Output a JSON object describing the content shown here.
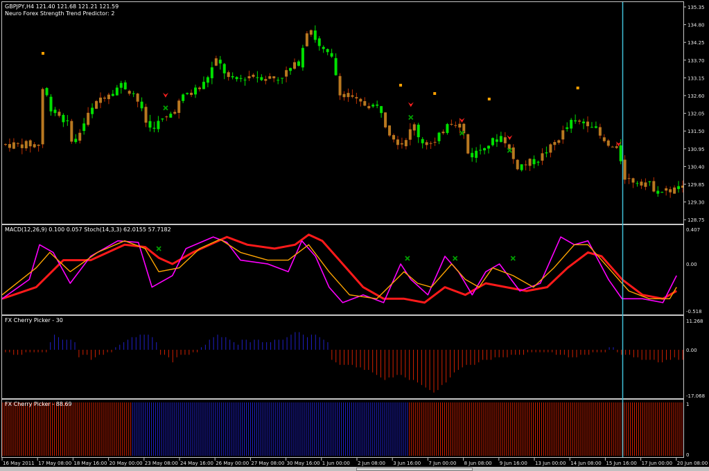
{
  "header": {
    "symbol_line": "GBPJPY,H4  121.40 121.68 121.21 121.59",
    "indicator_line": "Neuro Forex Strength Trend Predictor: 2"
  },
  "panes": {
    "macd_label": "MACD(12,26,9) 0.100 0.057  Stoch(14,3,3) 62.0155 57.7182",
    "cherry1_label": "FX Cherry Picker - 30",
    "cherry2_label": "FX Cherry Picker - 88.69"
  },
  "colors": {
    "bull": "#00e000",
    "bear": "#b87820",
    "macd": "#ff1a1a",
    "stoch_main": "#ff00ff",
    "stoch_signal": "#ffa500",
    "hist_pos": "#2020c8",
    "hist_neg": "#d02000",
    "vline": "#40c0d8",
    "marker_x": "#00a000",
    "arrow": "#ff2020",
    "dot": "#ffa000"
  },
  "chart_data": [
    {
      "type": "candlestick",
      "title": "GBPJPY,H4",
      "y_ticks": [
        "135.35",
        "134.80",
        "134.25",
        "133.70",
        "133.15",
        "132.60",
        "132.05",
        "131.50",
        "130.95",
        "130.40",
        "129.85",
        "129.30",
        "128.75"
      ],
      "ylim": [
        128.75,
        135.35
      ],
      "bull_runs": [
        {
          "from": 0.055,
          "to": 0.19,
          "lo": 130.9,
          "hi": 133.05
        },
        {
          "from": 0.215,
          "to": 0.245,
          "lo": 131.7,
          "hi": 132.4
        },
        {
          "from": 0.255,
          "to": 0.42,
          "lo": 131.9,
          "hi": 134.8
        },
        {
          "from": 0.43,
          "to": 0.49,
          "lo": 133.2,
          "hi": 135.0
        },
        {
          "from": 0.635,
          "to": 0.65,
          "lo": 131.0,
          "hi": 131.9
        },
        {
          "from": 0.69,
          "to": 0.73,
          "lo": 130.7,
          "hi": 131.4
        },
        {
          "from": 0.76,
          "to": 0.8,
          "lo": 130.2,
          "hi": 131.2
        },
        {
          "from": 0.82,
          "to": 0.87,
          "lo": 131.2,
          "hi": 132.3
        }
      ],
      "path": [
        [
          0,
          131.0
        ],
        [
          0.05,
          131.0
        ],
        [
          0.055,
          132.95
        ],
        [
          0.065,
          132.2
        ],
        [
          0.09,
          131.7
        ],
        [
          0.1,
          131.0
        ],
        [
          0.12,
          131.9
        ],
        [
          0.14,
          132.5
        ],
        [
          0.17,
          132.9
        ],
        [
          0.19,
          132.6
        ],
        [
          0.21,
          131.5
        ],
        [
          0.24,
          131.9
        ],
        [
          0.26,
          132.5
        ],
        [
          0.29,
          132.9
        ],
        [
          0.31,
          133.7
        ],
        [
          0.33,
          133.0
        ],
        [
          0.36,
          133.2
        ],
        [
          0.4,
          133.1
        ],
        [
          0.43,
          133.6
        ],
        [
          0.445,
          134.85
        ],
        [
          0.46,
          134.1
        ],
        [
          0.48,
          133.7
        ],
        [
          0.49,
          132.7
        ],
        [
          0.52,
          132.3
        ],
        [
          0.55,
          132.2
        ],
        [
          0.56,
          131.5
        ],
        [
          0.58,
          131.0
        ],
        [
          0.6,
          131.6
        ],
        [
          0.61,
          131.1
        ],
        [
          0.63,
          131.0
        ],
        [
          0.65,
          131.8
        ],
        [
          0.67,
          131.6
        ],
        [
          0.68,
          130.6
        ],
        [
          0.7,
          130.9
        ],
        [
          0.73,
          131.3
        ],
        [
          0.75,
          130.3
        ],
        [
          0.78,
          130.5
        ],
        [
          0.8,
          130.9
        ],
        [
          0.83,
          131.7
        ],
        [
          0.86,
          131.7
        ],
        [
          0.88,
          131.0
        ],
        [
          0.9,
          130.8
        ],
        [
          0.91,
          129.9
        ],
        [
          0.94,
          129.8
        ],
        [
          0.96,
          129.5
        ],
        [
          0.99,
          129.6
        ]
      ],
      "signal_arrows": [
        0.24,
        0.6,
        0.675,
        0.745,
        0.905
      ],
      "signal_x": [
        0.24,
        0.6,
        0.675,
        0.745
      ],
      "signal_dots": [
        0.06,
        0.585,
        0.635,
        0.715,
        0.845
      ]
    },
    {
      "type": "line",
      "title": "MACD(12,26,9) 0.100 0.057  Stoch(14,3,3) 62.0155 57.7182",
      "y_ticks": [
        "0.407",
        "0.00",
        "-0.518"
      ],
      "ylim": [
        -0.6,
        0.45
      ],
      "series": [
        {
          "role": "macd",
          "values": [
            [
              0,
              -0.45
            ],
            [
              0.05,
              -0.3
            ],
            [
              0.09,
              0.05
            ],
            [
              0.13,
              0.05
            ],
            [
              0.18,
              0.25
            ],
            [
              0.21,
              0.22
            ],
            [
              0.23,
              0.08
            ],
            [
              0.25,
              0.0
            ],
            [
              0.28,
              0.15
            ],
            [
              0.33,
              0.35
            ],
            [
              0.36,
              0.25
            ],
            [
              0.4,
              0.2
            ],
            [
              0.43,
              0.25
            ],
            [
              0.45,
              0.38
            ],
            [
              0.47,
              0.3
            ],
            [
              0.5,
              0.0
            ],
            [
              0.53,
              -0.3
            ],
            [
              0.56,
              -0.45
            ],
            [
              0.59,
              -0.45
            ],
            [
              0.62,
              -0.5
            ],
            [
              0.65,
              -0.3
            ],
            [
              0.68,
              -0.4
            ],
            [
              0.71,
              -0.25
            ],
            [
              0.74,
              -0.3
            ],
            [
              0.77,
              -0.35
            ],
            [
              0.8,
              -0.3
            ],
            [
              0.83,
              -0.05
            ],
            [
              0.86,
              0.15
            ],
            [
              0.88,
              0.1
            ],
            [
              0.91,
              -0.2
            ],
            [
              0.94,
              -0.4
            ],
            [
              0.97,
              -0.45
            ],
            [
              0.99,
              -0.35
            ]
          ]
        },
        {
          "role": "stoch_main",
          "values": [
            [
              0,
              -0.45
            ],
            [
              0.04,
              -0.2
            ],
            [
              0.055,
              0.25
            ],
            [
              0.075,
              0.15
            ],
            [
              0.1,
              -0.25
            ],
            [
              0.13,
              0.1
            ],
            [
              0.17,
              0.3
            ],
            [
              0.2,
              0.28
            ],
            [
              0.22,
              -0.3
            ],
            [
              0.25,
              -0.15
            ],
            [
              0.27,
              0.2
            ],
            [
              0.31,
              0.35
            ],
            [
              0.33,
              0.28
            ],
            [
              0.35,
              0.05
            ],
            [
              0.39,
              0.0
            ],
            [
              0.42,
              -0.1
            ],
            [
              0.44,
              0.3
            ],
            [
              0.46,
              0.1
            ],
            [
              0.48,
              -0.3
            ],
            [
              0.5,
              -0.5
            ],
            [
              0.53,
              -0.4
            ],
            [
              0.56,
              -0.5
            ],
            [
              0.585,
              0.0
            ],
            [
              0.6,
              -0.2
            ],
            [
              0.625,
              -0.4
            ],
            [
              0.65,
              0.1
            ],
            [
              0.67,
              -0.1
            ],
            [
              0.69,
              -0.4
            ],
            [
              0.71,
              -0.1
            ],
            [
              0.73,
              0.0
            ],
            [
              0.76,
              -0.35
            ],
            [
              0.79,
              -0.25
            ],
            [
              0.82,
              0.35
            ],
            [
              0.84,
              0.25
            ],
            [
              0.86,
              0.3
            ],
            [
              0.89,
              -0.2
            ],
            [
              0.91,
              -0.45
            ],
            [
              0.94,
              -0.45
            ],
            [
              0.97,
              -0.5
            ],
            [
              0.99,
              -0.15
            ]
          ]
        },
        {
          "role": "stoch_signal",
          "values": [
            [
              0,
              -0.4
            ],
            [
              0.05,
              -0.05
            ],
            [
              0.07,
              0.15
            ],
            [
              0.1,
              -0.1
            ],
            [
              0.14,
              0.15
            ],
            [
              0.18,
              0.3
            ],
            [
              0.21,
              0.2
            ],
            [
              0.23,
              -0.1
            ],
            [
              0.26,
              -0.05
            ],
            [
              0.29,
              0.2
            ],
            [
              0.32,
              0.32
            ],
            [
              0.35,
              0.15
            ],
            [
              0.39,
              0.05
            ],
            [
              0.42,
              0.05
            ],
            [
              0.45,
              0.25
            ],
            [
              0.48,
              -0.1
            ],
            [
              0.51,
              -0.4
            ],
            [
              0.55,
              -0.45
            ],
            [
              0.59,
              -0.1
            ],
            [
              0.61,
              -0.25
            ],
            [
              0.63,
              -0.3
            ],
            [
              0.66,
              0.0
            ],
            [
              0.68,
              -0.2
            ],
            [
              0.7,
              -0.3
            ],
            [
              0.72,
              -0.05
            ],
            [
              0.75,
              -0.15
            ],
            [
              0.78,
              -0.3
            ],
            [
              0.81,
              -0.05
            ],
            [
              0.84,
              0.25
            ],
            [
              0.86,
              0.25
            ],
            [
              0.89,
              -0.05
            ],
            [
              0.92,
              -0.35
            ],
            [
              0.95,
              -0.45
            ],
            [
              0.98,
              -0.45
            ],
            [
              0.99,
              -0.3
            ]
          ]
        }
      ],
      "markers_x": [
        0.23,
        0.595,
        0.665,
        0.75
      ]
    },
    {
      "type": "bar",
      "title": "FX Cherry Picker - 30",
      "y_ticks": [
        "11.268",
        "0.00",
        "-17.068"
      ],
      "ylim": [
        -17.068,
        11.268
      ],
      "values": [
        -1,
        -1,
        -2,
        -2,
        -2,
        -1,
        -1,
        -1,
        -1,
        -1,
        -1,
        3,
        6,
        5,
        4,
        4,
        4,
        3,
        -3,
        -2,
        -2,
        -4,
        -3,
        -2,
        -2,
        -1,
        -1,
        1,
        2,
        3,
        4,
        5,
        5,
        6,
        6,
        6,
        5,
        3,
        -2,
        -2,
        -3,
        -5,
        -3,
        -2,
        -2,
        -2,
        -1,
        -1,
        1,
        2,
        4,
        5,
        6,
        5,
        5,
        4,
        3,
        2,
        4,
        4,
        3,
        4,
        4,
        3,
        3,
        3,
        4,
        4,
        4,
        5,
        6,
        7,
        7,
        6,
        5,
        6,
        6,
        5,
        4,
        3,
        -4,
        -5,
        -6,
        -6,
        -6,
        -6,
        -7,
        -7,
        -8,
        -8,
        -9,
        -10,
        -11,
        -12,
        -11,
        -11,
        -10,
        -10,
        -11,
        -12,
        -12,
        -13,
        -14,
        -15,
        -16,
        -17,
        -16,
        -14,
        -13,
        -11,
        -9,
        -8,
        -7,
        -6,
        -6,
        -6,
        -5,
        -4,
        -4,
        -4,
        -3,
        -3,
        -3,
        -3,
        -2,
        -2,
        -2,
        -2,
        -1,
        -1,
        -1,
        -1,
        -1,
        -1,
        -1,
        -2,
        -2,
        -2,
        -3,
        -3,
        -3,
        -2,
        -2,
        -2,
        -1,
        -1,
        -1,
        -1,
        1,
        1,
        -1,
        -2,
        -2,
        -2,
        -3,
        -3,
        -4,
        -4,
        -4,
        -4,
        -5,
        -5,
        -4,
        -4,
        -3,
        -4,
        -4
      ]
    },
    {
      "type": "bar",
      "title": "FX Cherry Picker - 88.69",
      "y_ticks": [
        "1",
        "0"
      ],
      "ylim": [
        0,
        1
      ],
      "segments": [
        {
          "from": 0.0,
          "to": 0.19,
          "state": "red"
        },
        {
          "from": 0.19,
          "to": 0.595,
          "state": "blue"
        },
        {
          "from": 0.595,
          "to": 1.0,
          "state": "red"
        }
      ]
    }
  ],
  "x_axis": [
    "16 May 2011",
    "17 May 08:00",
    "18 May 16:00",
    "20 May 00:00",
    "23 May 08:00",
    "24 May 16:00",
    "26 May 00:00",
    "27 May 08:00",
    "30 May 16:00",
    "1 Jun 00:00",
    "2 Jun 08:00",
    "3 Jun 16:00",
    "7 Jun 00:00",
    "8 Jun 08:00",
    "9 Jun 16:00",
    "13 Jun 00:00",
    "14 Jun 08:00",
    "15 Jun 16:00",
    "17 Jun 00:00",
    "20 Jun 08:00"
  ],
  "vline_at": 0.912
}
